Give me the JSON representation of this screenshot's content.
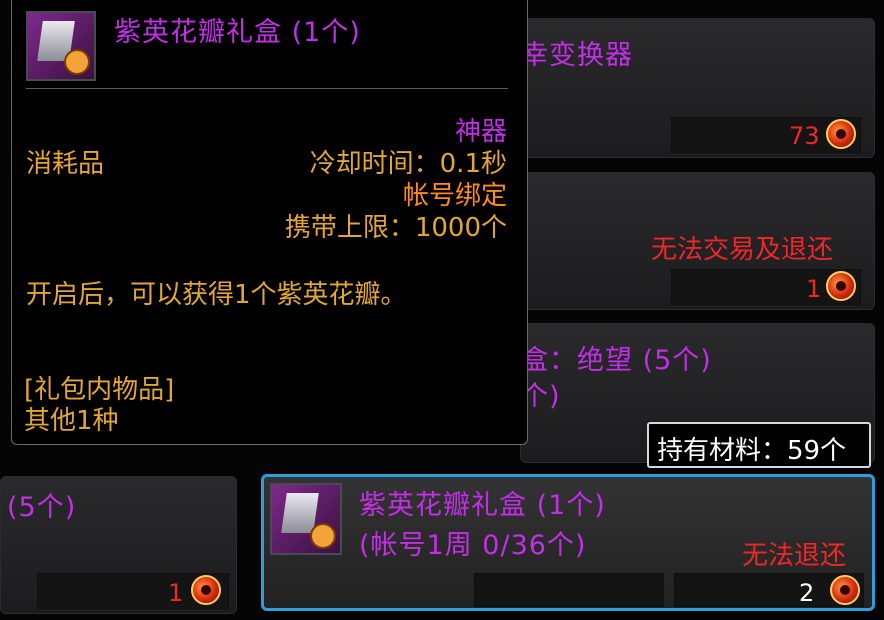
{
  "tooltip": {
    "item_name": "紫英花瓣礼盒 (1个)",
    "category": "消耗品",
    "rarity": "神器",
    "cooldown": "冷却时间：0.1秒",
    "binding": "帐号绑定",
    "carry_limit": "携带上限：1000个",
    "description": "开启后，可以获得1个紫英花瓣。",
    "package_header": "[礼包内物品]",
    "package_content": "其他1种"
  },
  "list_items": [
    {
      "name_partial": "幸变换器",
      "count": "73"
    },
    {
      "restriction": "无法交易及退还",
      "count": "1"
    },
    {
      "name_partial": "盒：绝望 (5个)",
      "sub_partial": "个)"
    },
    {
      "name_partial": "(5个)",
      "count": "1"
    },
    {
      "name": "紫英花瓣礼盒 (1个)",
      "subtitle": "(帐号1周 0/36个)",
      "restriction": "无法退还",
      "count": "2"
    }
  ],
  "materials": {
    "label": "持有材料：59个"
  },
  "colors": {
    "rarity_purple": "#c22fe6",
    "restriction_red": "#ef2727",
    "info_gold": "#e2a632",
    "selection_blue": "#2c9fd8"
  },
  "icons": {
    "item_icon": "purple-box-icon",
    "currency_icon": "coin-icon"
  }
}
